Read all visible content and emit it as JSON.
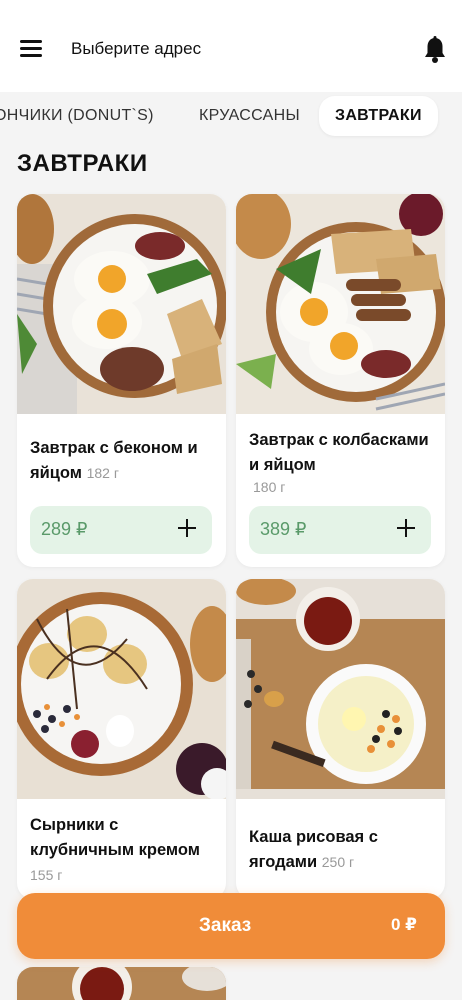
{
  "header": {
    "address_label": "Выберите адрес",
    "menu_icon": "hamburger-menu-icon",
    "notification_icon": "bell-icon"
  },
  "tabs": [
    {
      "label": "ОНЧИКИ (DONUT`S)",
      "active": false
    },
    {
      "label": "КРУАССАНЫ",
      "active": false
    },
    {
      "label": "ЗАВТРАКИ",
      "active": true
    }
  ],
  "section": {
    "title": "ЗАВТРАКИ"
  },
  "products": [
    {
      "name": "Завтрак с беконом и яйцом",
      "weight": "182 г",
      "price": "289 ₽"
    },
    {
      "name": "Завтрак с колбасками и яйцом",
      "weight": "180 г",
      "price": "389 ₽"
    },
    {
      "name": "Сырники с клубничным кремом",
      "weight": "155 г"
    },
    {
      "name": "Каша рисовая с ягодами",
      "weight": "250 г"
    }
  ],
  "order": {
    "label": "Заказ",
    "total": "0 ₽"
  },
  "colors": {
    "accent": "#f08c39",
    "price_bg": "#e4f3e7",
    "price_text": "#5a9a6a"
  }
}
